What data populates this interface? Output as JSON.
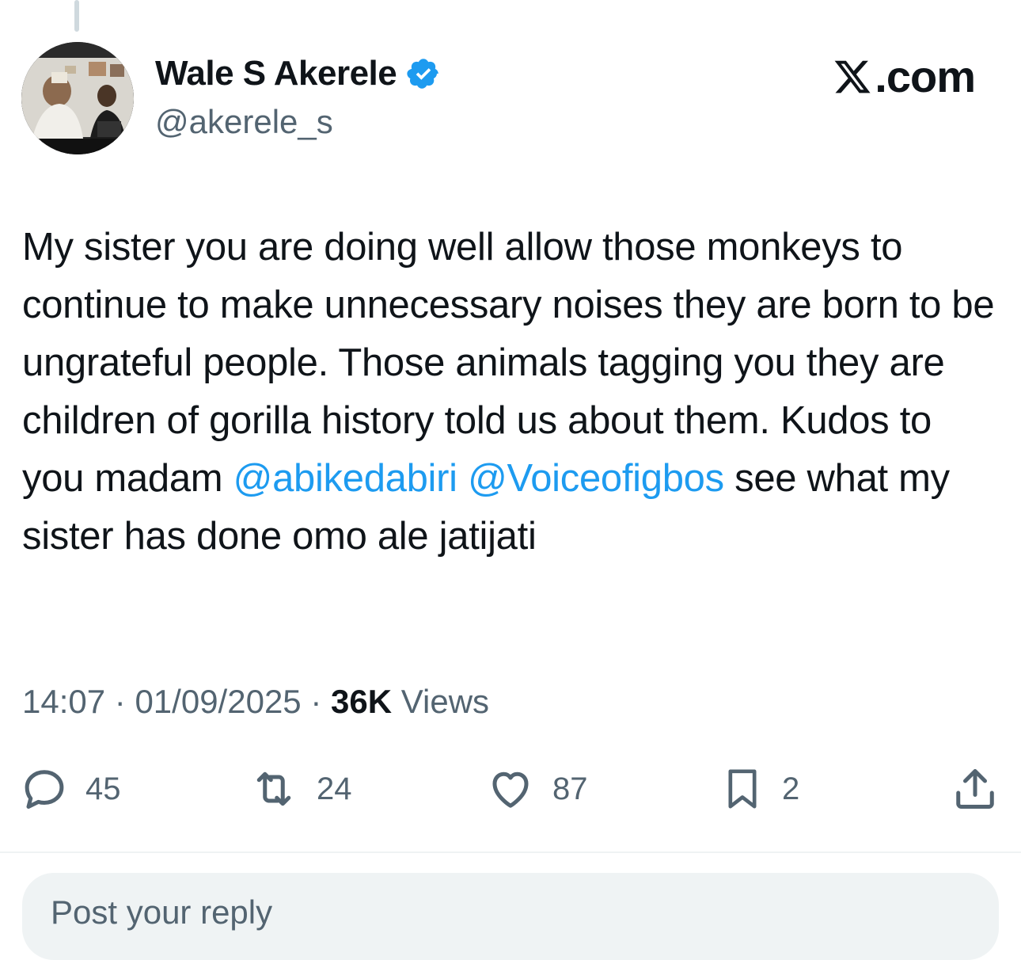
{
  "author": {
    "display_name": "Wale S Akerele",
    "handle": "@akerele_s",
    "verified": true,
    "avatar": "profile-photo"
  },
  "brand": {
    "label": ".com",
    "logo_icon": "x-logo-icon"
  },
  "tweet": {
    "text_part1": "My sister you are doing well allow those monkeys to continue to make unnecessary noises they are born to be ungrateful people. Those animals tagging you they are children of gorilla history told us about them.  Kudos to you madam ",
    "mention1": "@abikedabiri",
    "mention2": "@Voiceofigbos",
    "text_part2": " see what my sister has done omo ale jatijati"
  },
  "meta": {
    "time": "14:07",
    "separator": "·",
    "date": "01/09/2025",
    "views_count": "36K",
    "views_label": "Views"
  },
  "actions": {
    "replies": "45",
    "reposts": "24",
    "likes": "87",
    "bookmarks": "2"
  },
  "reply": {
    "placeholder": "Post your reply"
  },
  "colors": {
    "accent": "#1d9bf0",
    "text": "#0f1419",
    "secondary": "#536471"
  }
}
